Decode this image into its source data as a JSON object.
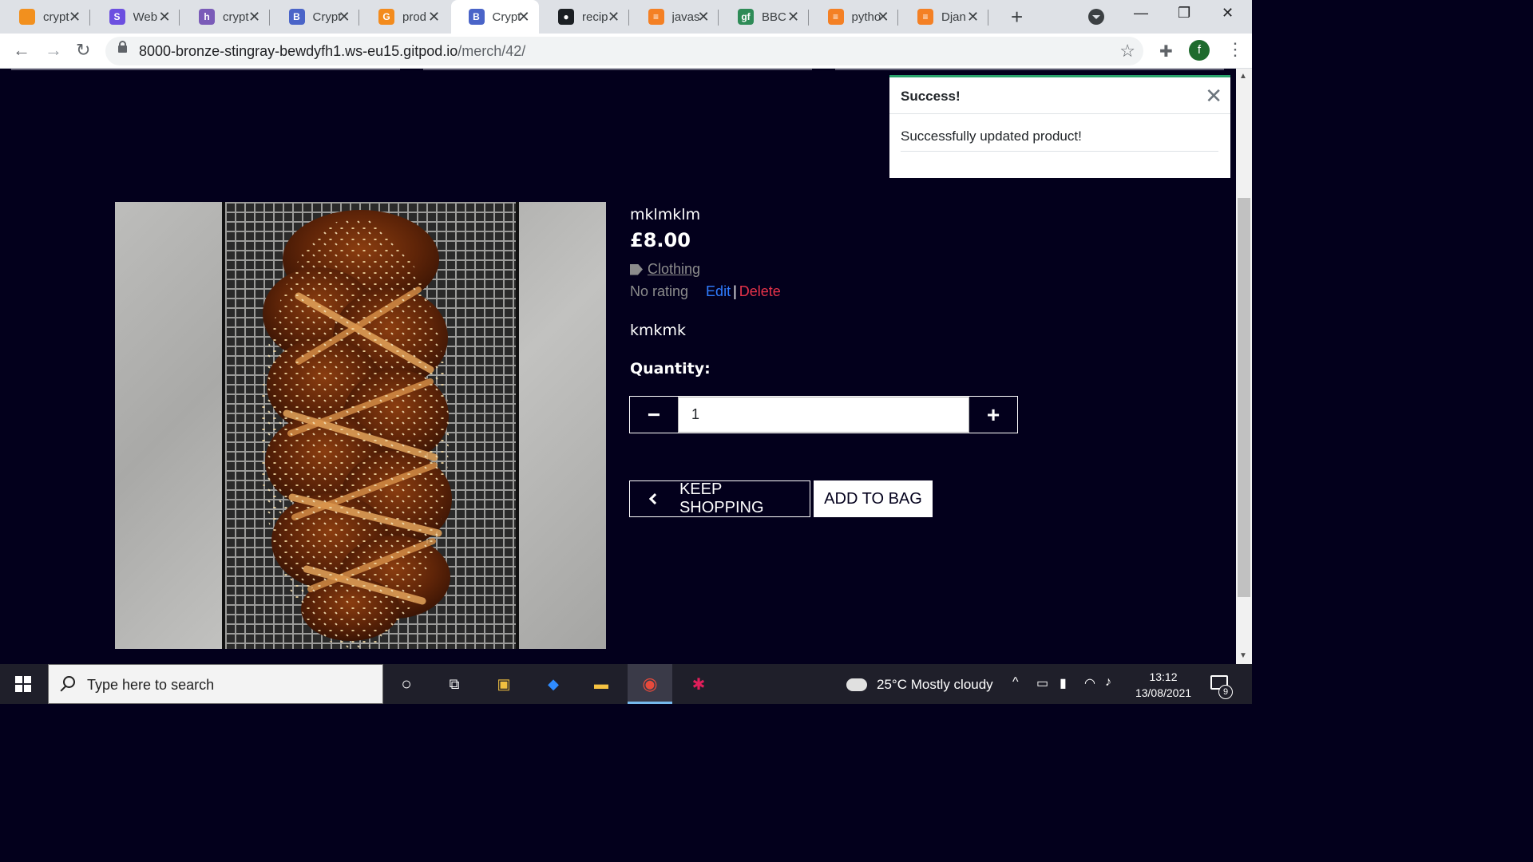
{
  "browser": {
    "tabs": [
      {
        "title": "crypt",
        "favicon": "box-icon",
        "color": "#f2901e",
        "glyph": ""
      },
      {
        "title": "Web",
        "favicon": "s-logo-icon",
        "color": "#6c4fe0",
        "glyph": "S"
      },
      {
        "title": "crypt",
        "favicon": "h-logo-icon",
        "color": "#7a5bb8",
        "glyph": "h"
      },
      {
        "title": "Crypt",
        "favicon": "b-logo-icon",
        "color": "#4a64c8",
        "glyph": "B"
      },
      {
        "title": "prod",
        "favicon": "g-logo-icon",
        "color": "#f38b1d",
        "glyph": "G"
      },
      {
        "title": "Crypt",
        "favicon": "b-logo-icon",
        "color": "#4a64c8",
        "glyph": "B"
      },
      {
        "title": "recip",
        "favicon": "github-icon",
        "color": "#1b1f23",
        "glyph": "●"
      },
      {
        "title": "javas",
        "favicon": "stackoverflow-icon",
        "color": "#f48024",
        "glyph": "≡"
      },
      {
        "title": "BBC",
        "favicon": "gf-logo-icon",
        "color": "#2e8b57",
        "glyph": "gf"
      },
      {
        "title": "pytho",
        "favicon": "stackoverflow-icon",
        "color": "#f48024",
        "glyph": "≡"
      },
      {
        "title": "Djan",
        "favicon": "stackoverflow-icon",
        "color": "#f48024",
        "glyph": "≡"
      }
    ],
    "active_tab_index": 5,
    "url_host": "8000-bronze-stingray-bewdyfh1.ws-eu15.gitpod.io",
    "url_path": "/merch/42/",
    "profile_initial": "f"
  },
  "product": {
    "name": "mklmklm",
    "price": "£8.00",
    "category": "Clothing",
    "rating": "No rating",
    "edit_label": "Edit",
    "separator": "|",
    "delete_label": "Delete",
    "description": "kmkmk",
    "quantity_label": "Quantity:",
    "quantity_value": "1",
    "decrement_symbol": "−",
    "increment_symbol": "+",
    "keep_shopping_label": "KEEP SHOPPING",
    "add_to_bag_label": "ADD TO BAG"
  },
  "toast": {
    "title": "Success!",
    "message": "Successfully updated product!",
    "close_symbol": "✕",
    "accent_color": "#29a36b"
  },
  "taskbar": {
    "search_placeholder": "Type here to search",
    "weather": "25°C  Mostly cloudy",
    "time": "13:12",
    "date": "13/08/2021",
    "notification_count": "9"
  }
}
